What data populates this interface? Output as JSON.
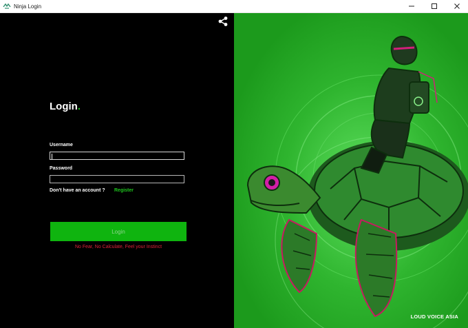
{
  "window": {
    "title": "Ninja Login",
    "controls": {
      "minimize": "—",
      "maximize": "☐",
      "close": "✕"
    }
  },
  "header": {
    "share_icon": "share-icon"
  },
  "form": {
    "title": "Login",
    "title_dot": ".",
    "username_label": "Username",
    "username_value": "",
    "password_label": "Password",
    "password_value": "",
    "no_account_text": "Don't have an account ?",
    "register_label": "Register",
    "login_button": "Login",
    "tagline": "No Fear, No Calculate, Feel your Instinct"
  },
  "hero": {
    "brand": "LOUD VOICE ASIA",
    "background_color": "#22a522"
  },
  "colors": {
    "accent": "#1ec51e",
    "button": "#0fb40f",
    "tagline": "#e0223a",
    "panel": "#000000"
  }
}
